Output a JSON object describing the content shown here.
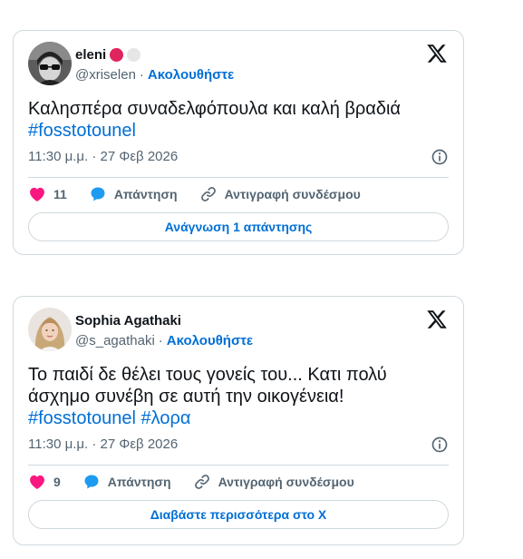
{
  "tweets": [
    {
      "display_name": "eleni",
      "handle": "@xriselen",
      "separator": "·",
      "follow_label": "Ακολουθήστε",
      "text": "Καλησπέρα συναδελφόπουλα και καλή βραδιά",
      "hashtags": [
        "#fosstotounel"
      ],
      "timestamp": "11:30 μ.μ. · 27 Φεβ 2026",
      "likes": "11",
      "reply_label": "Απάντηση",
      "copy_link_label": "Αντιγραφή συνδέσμου",
      "button_label": "Ανάγνωση 1 απάντησης",
      "name_emojis": [
        "red-circle",
        "white-circle"
      ]
    },
    {
      "display_name": "Sophia Agathaki",
      "handle": "@s_agathaki",
      "separator": "·",
      "follow_label": "Ακολουθήστε",
      "text_line1": "Το παιδί δε θέλει τους γονείς του... Κατι πολύ",
      "text_line2": "άσχημο συνέβη σε αυτή την οικογένεια!",
      "hashtags": [
        "#fosstotounel",
        "#λορα"
      ],
      "timestamp": "11:30 μ.μ. · 27 Φεβ 2026",
      "likes": "9",
      "reply_label": "Απάντηση",
      "copy_link_label": "Αντιγραφή συνδέσμου",
      "button_label": "Διαβάστε περισσότερα στο X"
    }
  ],
  "colors": {
    "accent": "#006fd6",
    "like": "#f91880",
    "reply": "#1d9bf0",
    "muted": "#536471",
    "border": "#cfd9de"
  }
}
